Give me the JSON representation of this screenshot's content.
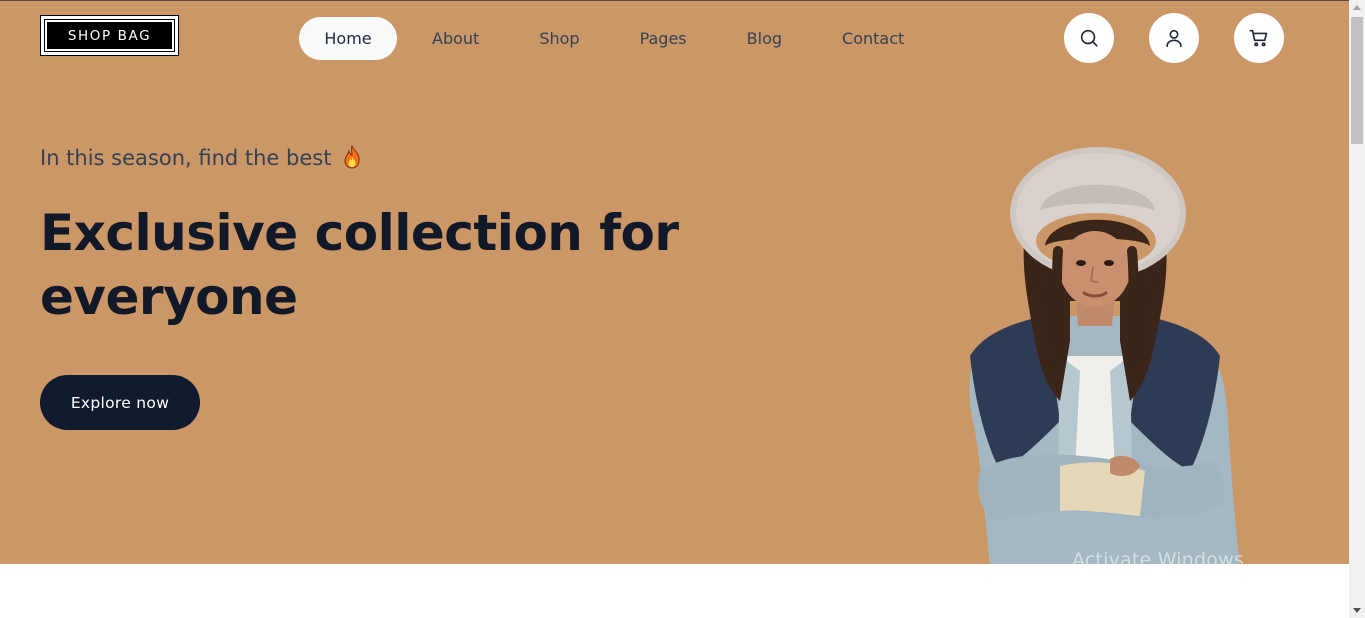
{
  "brand": {
    "logo_text": "SHOP BAG"
  },
  "nav": {
    "items": [
      {
        "label": "Home",
        "active": true
      },
      {
        "label": "About",
        "active": false
      },
      {
        "label": "Shop",
        "active": false
      },
      {
        "label": "Pages",
        "active": false
      },
      {
        "label": "Blog",
        "active": false
      },
      {
        "label": "Contact",
        "active": false
      }
    ]
  },
  "header_icons": [
    "search-icon",
    "user-icon",
    "cart-icon"
  ],
  "hero": {
    "subtitle": "In this season, find the best",
    "subtitle_emoji": "fire-icon",
    "headline": "Exclusive collection for everyone",
    "cta_label": "Explore now",
    "background_color": "#cc9766",
    "image": "woman-in-hat-photo"
  },
  "os_watermark": "Activate Windows",
  "colors": {
    "accent_dark": "#111a2e",
    "text_primary": "#111827",
    "text_secondary": "#334155",
    "nav_active_bg": "#f8fafc"
  }
}
